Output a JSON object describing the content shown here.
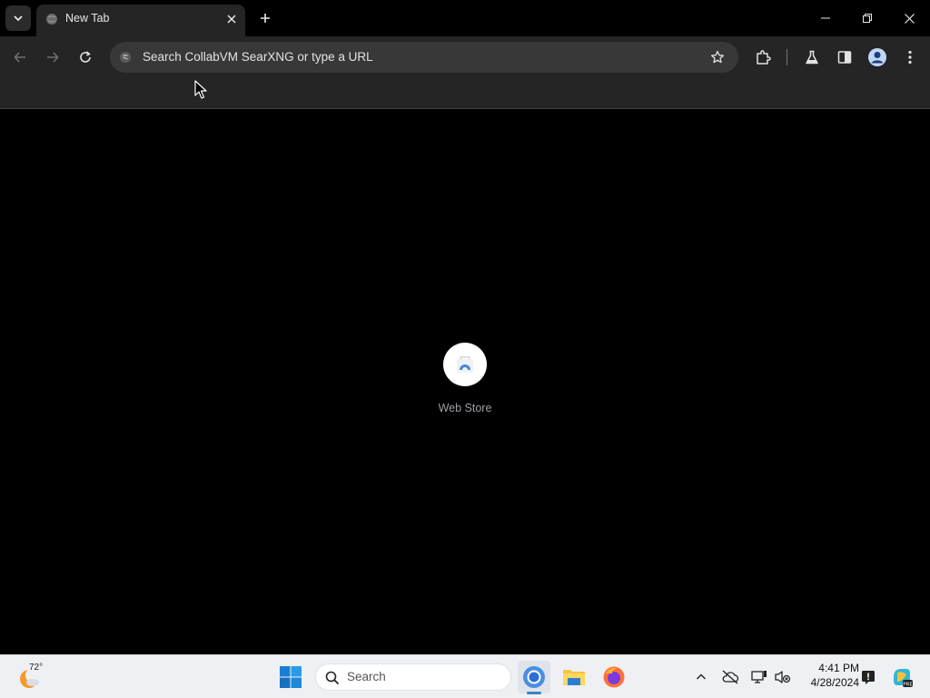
{
  "tabstrip": {
    "tab_title": "New Tab"
  },
  "toolbar": {
    "omnibox_placeholder": "Search CollabVM SearXNG or type a URL"
  },
  "content": {
    "shortcut_label": "Web Store"
  },
  "taskbar": {
    "weather_temp": "72°",
    "search_placeholder": "Search",
    "time": "4:41 PM",
    "date": "4/28/2024"
  },
  "colors": {
    "tab_bg": "#252525",
    "toolbar_bg": "#252525",
    "omnibox_bg": "#383838",
    "content_bg": "#000000",
    "taskbar_bg": "#eef0f4",
    "accent": "#3b82c4"
  },
  "icons": {
    "tab_list": "chevron-down-icon",
    "tab_favicon": "globe-icon",
    "tab_close": "close-icon",
    "new_tab": "plus-icon",
    "back": "arrow-left-icon",
    "forward": "arrow-right-icon",
    "reload": "reload-icon",
    "site_info": "site-info-icon",
    "bookmark": "star-icon",
    "extensions": "puzzle-icon",
    "labs": "flask-icon",
    "side_panel": "side-panel-icon",
    "profile": "profile-icon",
    "menu": "kebab-menu-icon"
  }
}
